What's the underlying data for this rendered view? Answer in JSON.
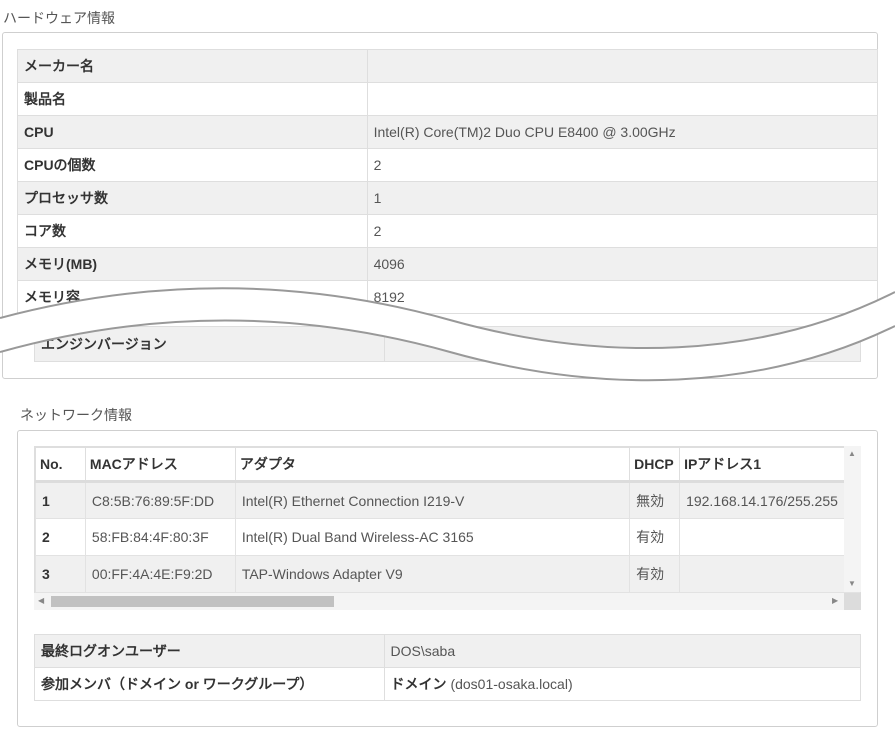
{
  "hardware": {
    "title": "ハードウェア情報",
    "rows": [
      {
        "key": "メーカー名",
        "value": ""
      },
      {
        "key": "製品名",
        "value": ""
      },
      {
        "key": "CPU",
        "value": "Intel(R) Core(TM)2 Duo CPU E8400 @ 3.00GHz"
      },
      {
        "key": "CPUの個数",
        "value": "2"
      },
      {
        "key": "プロセッサ数",
        "value": "1"
      },
      {
        "key": "コア数",
        "value": "2"
      },
      {
        "key": "メモリ(MB)",
        "value": "4096"
      },
      {
        "key": "メモリ容",
        "value": "8192"
      }
    ],
    "engine_label": "エンジンバージョン",
    "engine_value": ""
  },
  "network": {
    "title": "ネットワーク情報",
    "columns": [
      "No.",
      "MACアドレス",
      "アダプタ",
      "DHCP",
      "IPアドレス1"
    ],
    "rows": [
      {
        "no": "1",
        "mac": "C8:5B:76:89:5F:DD",
        "adapter": "Intel(R) Ethernet Connection I219-V",
        "dhcp": "無効",
        "ip": "192.168.14.176/255.255"
      },
      {
        "no": "2",
        "mac": "58:FB:84:4F:80:3F",
        "adapter": "Intel(R) Dual Band Wireless-AC 3165",
        "dhcp": "有効",
        "ip": ""
      },
      {
        "no": "3",
        "mac": "00:FF:4A:4E:F9:2D",
        "adapter": "TAP-Windows Adapter V9",
        "dhcp": "有効",
        "ip": ""
      }
    ],
    "last_user_label": "最終ログオンユーザー",
    "last_user_value": "DOS\\saba",
    "member_label": "参加メンバ（ドメイン or ワークグループ）",
    "member_type": "ドメイン",
    "member_value": "(dos01-osaka.local)"
  }
}
